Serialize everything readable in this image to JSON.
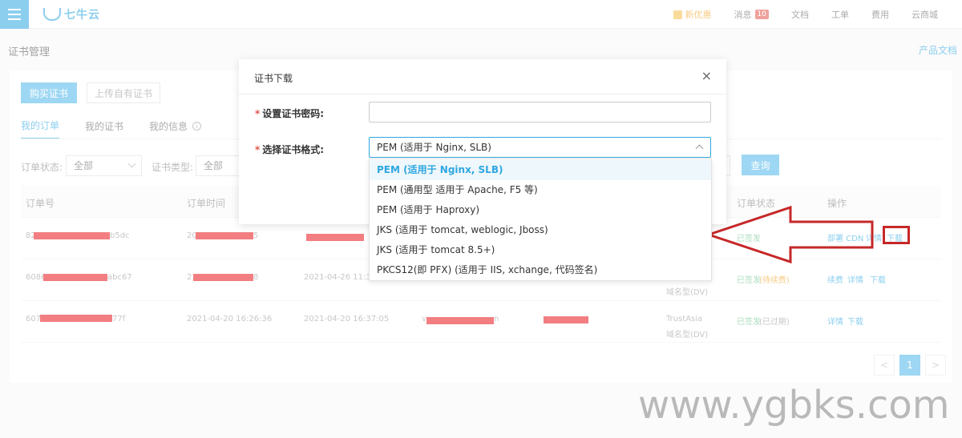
{
  "topbar": {
    "brand": "七牛云",
    "nav": [
      {
        "label": "新优惠",
        "kind": "promo"
      },
      {
        "label": "消息",
        "badge": "10"
      },
      {
        "label": "文档"
      },
      {
        "label": "工单"
      },
      {
        "label": "费用"
      },
      {
        "label": "云商城"
      }
    ]
  },
  "page": {
    "title": "证书管理",
    "doc_link": "产品文档"
  },
  "actions": {
    "buy": "购买证书",
    "upload": "上传自有证书"
  },
  "tabs": [
    {
      "label": "我的订单",
      "active": true
    },
    {
      "label": "我的证书"
    },
    {
      "label": "我的信息",
      "icon": "info-icon"
    }
  ],
  "filters": {
    "status_label": "订单状态:",
    "status_value": "全部",
    "type_label": "证书类型:",
    "type_value": "全部",
    "query_button": "查询"
  },
  "table": {
    "headers": [
      "订单号",
      "订单时间",
      "订单状态",
      "操作"
    ],
    "rows": [
      {
        "order_prefix": "82",
        "order_suffix": "b5dc",
        "time_prefix": "20",
        "time_suffix": "5",
        "product": "",
        "brand": "",
        "status": "已签发",
        "status_extra": "",
        "actions": [
          "部署 CDN",
          "详情",
          "下载"
        ]
      },
      {
        "order_prefix": "6086",
        "order_suffix": "abc67",
        "time_prefix": "2",
        "time_suffix": "8",
        "time2": "2021-04-26 11:37:5",
        "product": "",
        "brand": "域名型(DV)",
        "status": "已签发",
        "status_extra": "(待续费)",
        "actions": [
          "续费",
          "详情",
          "下载"
        ]
      },
      {
        "order_prefix": "607",
        "order_suffix": "77f",
        "time": "2021-04-20 16:26:36",
        "time2": "2021-04-20 16:37:05",
        "product_prefix": "v",
        "product_suffix": "n",
        "brand": "TrustAsia",
        "brand2": "域名型(DV)",
        "status": "已签发",
        "status_extra": "(已过期)",
        "actions": [
          "详情",
          "下载"
        ]
      }
    ]
  },
  "pagination": {
    "prev": "<",
    "current": "1",
    "next": ">"
  },
  "modal": {
    "title": "证书下载",
    "close": "×",
    "password_label": "设置证书密码:",
    "password_value": "",
    "format_label": "选择证书格式:",
    "format_value": "PEM (适用于 Nginx, SLB)",
    "required_mark": "*"
  },
  "dropdown": {
    "options": [
      "PEM (适用于 Nginx, SLB)",
      "PEM (通用型 适用于 Apache, F5 等)",
      "PEM (适用于 Haproxy)",
      "JKS (适用于 tomcat, weblogic, Jboss)",
      "JKS (适用于 tomcat 8.5+)",
      "PKCS12(即 PFX) (适用于 IIS, xchange, 代码签名)"
    ],
    "selected_index": 0
  },
  "annotation": {
    "arrow_color": "#c62828",
    "watermark": "www.ygbks.com"
  },
  "colors": {
    "accent": "#2ea7e0",
    "status_green": "#66c08a",
    "redaction": "#e8141b"
  }
}
